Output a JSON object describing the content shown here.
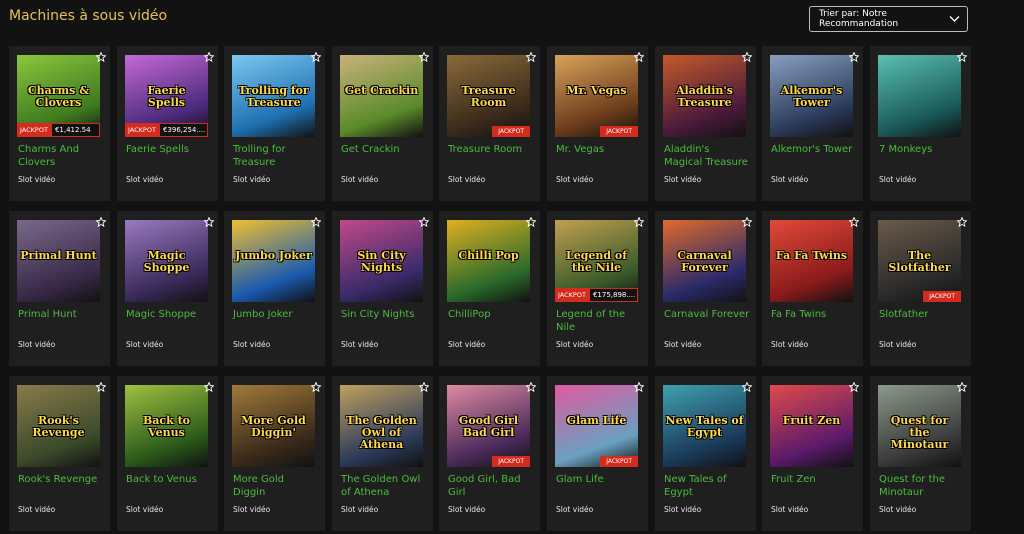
{
  "page": {
    "title": "Machines à sous vidéo"
  },
  "sort": {
    "label": "Trier par: Notre Recommandation"
  },
  "games": [
    {
      "name": "Charms And Clovers",
      "type": "Slot vidéo",
      "art": "Charms & Clovers",
      "jackpot": "full",
      "jackpot_label": "JACKPOT",
      "jackpot_amount": "€1,412.54",
      "c1": "#3d7a1d",
      "c2": "#8cc63f"
    },
    {
      "name": "Faerie Spells",
      "type": "Slot vidéo",
      "art": "Faerie Spells",
      "jackpot": "full",
      "jackpot_label": "JACKPOT",
      "jackpot_amount": "€396,254....",
      "c1": "#4a2a7a",
      "c2": "#c46ad6"
    },
    {
      "name": "Trolling for Treasure",
      "type": "Slot vidéo",
      "art": "Trolling for Treasure",
      "jackpot": "none",
      "c1": "#1e6fb0",
      "c2": "#7cc8f0"
    },
    {
      "name": "Get Crackin",
      "type": "Slot vidéo",
      "art": "Get Crackin",
      "jackpot": "none",
      "c1": "#5a8a2a",
      "c2": "#c9b27a"
    },
    {
      "name": "Treasure Room",
      "type": "Slot vidéo",
      "art": "Treasure Room",
      "jackpot": "red",
      "jackpot_label": "JACKPOT",
      "c1": "#3a2a1a",
      "c2": "#8a6a3a"
    },
    {
      "name": "Mr. Vegas",
      "type": "Slot vidéo",
      "art": "Mr. Vegas",
      "jackpot": "red",
      "jackpot_label": "JACKPOT",
      "c1": "#6a3a1a",
      "c2": "#d9a35a"
    },
    {
      "name": "Aladdin's Magical Treasure",
      "type": "Slot vidéo",
      "art": "Aladdin's Treasure",
      "jackpot": "none",
      "c1": "#4a1a3a",
      "c2": "#c45a2a"
    },
    {
      "name": "Alkemor's Tower",
      "type": "Slot vidéo",
      "art": "Alkemor's Tower",
      "jackpot": "none",
      "c1": "#2a3a5a",
      "c2": "#8aa0c0"
    },
    {
      "name": "7 Monkeys",
      "type": "Slot vidéo",
      "art": "",
      "jackpot": "none",
      "c1": "#1a5a5a",
      "c2": "#5ac0b0"
    },
    {
      "name": "Primal Hunt",
      "type": "Slot vidéo",
      "art": "Primal Hunt",
      "jackpot": "none",
      "c1": "#3a2a4a",
      "c2": "#7a6a8a"
    },
    {
      "name": "Magic Shoppe",
      "type": "Slot vidéo",
      "art": "Magic Shoppe",
      "jackpot": "none",
      "c1": "#3a2a5a",
      "c2": "#9a7ac0"
    },
    {
      "name": "Jumbo Joker",
      "type": "Slot vidéo",
      "art": "Jumbo Joker",
      "jackpot": "none",
      "c1": "#1a5ab0",
      "c2": "#f0c030"
    },
    {
      "name": "Sin City Nights",
      "type": "Slot vidéo",
      "art": "Sin City Nights",
      "jackpot": "none",
      "c1": "#3a2a6a",
      "c2": "#c04a8a"
    },
    {
      "name": "ChilliPop",
      "type": "Slot vidéo",
      "art": "Chilli Pop",
      "jackpot": "none",
      "c1": "#2a6a2a",
      "c2": "#e0b020"
    },
    {
      "name": "Legend of the Nile",
      "type": "Slot vidéo",
      "art": "Legend of the Nile",
      "jackpot": "full",
      "jackpot_label": "JACKPOT",
      "jackpot_amount": "€175,898....",
      "c1": "#3a5a2a",
      "c2": "#c0a050"
    },
    {
      "name": "Carnaval Forever",
      "type": "Slot vidéo",
      "art": "Carnaval Forever",
      "jackpot": "none",
      "c1": "#2a2a6a",
      "c2": "#e06a2a"
    },
    {
      "name": "Fa Fa Twins",
      "type": "Slot vidéo",
      "art": "Fa Fa Twins",
      "jackpot": "none",
      "c1": "#8a1a1a",
      "c2": "#e04a3a"
    },
    {
      "name": "Slotfather",
      "type": "Slot vidéo",
      "art": "The Slotfather",
      "jackpot": "red",
      "jackpot_label": "JACKPOT",
      "c1": "#2a2a2a",
      "c2": "#6a5a4a"
    },
    {
      "name": "Rook's Revenge",
      "type": "Slot vidéo",
      "art": "Rook's Revenge",
      "jackpot": "none",
      "c1": "#3a4a2a",
      "c2": "#8a7a4a"
    },
    {
      "name": "Back to Venus",
      "type": "Slot vidéo",
      "art": "Back to Venus",
      "jackpot": "none",
      "c1": "#2a5a1a",
      "c2": "#a0c040"
    },
    {
      "name": "More Gold Diggin",
      "type": "Slot vidéo",
      "art": "More Gold Diggin'",
      "jackpot": "none",
      "c1": "#3a2a1a",
      "c2": "#a07a3a"
    },
    {
      "name": "The Golden Owl of Athena",
      "type": "Slot vidéo",
      "art": "The Golden Owl of Athena",
      "jackpot": "none",
      "c1": "#2a3a5a",
      "c2": "#c0a060"
    },
    {
      "name": "Good Girl, Bad Girl",
      "type": "Slot vidéo",
      "art": "Good Girl Bad Girl",
      "jackpot": "red",
      "jackpot_label": "JACKPOT",
      "c1": "#4a2a5a",
      "c2": "#e08aa0"
    },
    {
      "name": "Glam Life",
      "type": "Slot vidéo",
      "art": "Glam Life",
      "jackpot": "red",
      "jackpot_label": "JACKPOT",
      "c1": "#6aa0c0",
      "c2": "#e05aa0"
    },
    {
      "name": "New Tales of Egypt",
      "type": "Slot vidéo",
      "art": "New Tales of Egypt",
      "jackpot": "none",
      "c1": "#1a3a5a",
      "c2": "#40a0b0"
    },
    {
      "name": "Fruit Zen",
      "type": "Slot vidéo",
      "art": "Fruit Zen",
      "jackpot": "none",
      "c1": "#5a1a6a",
      "c2": "#e04a4a"
    },
    {
      "name": "Quest for the Minotaur",
      "type": "Slot vidéo",
      "art": "Quest for the Minotaur",
      "jackpot": "none",
      "c1": "#3a3a3a",
      "c2": "#8a9a8a"
    }
  ],
  "colors": {
    "accent_title": "#e4c25c",
    "game_name": "#4dbb3f",
    "jackpot_red": "#d42b1e",
    "card_bg": "#1f1f1f"
  }
}
